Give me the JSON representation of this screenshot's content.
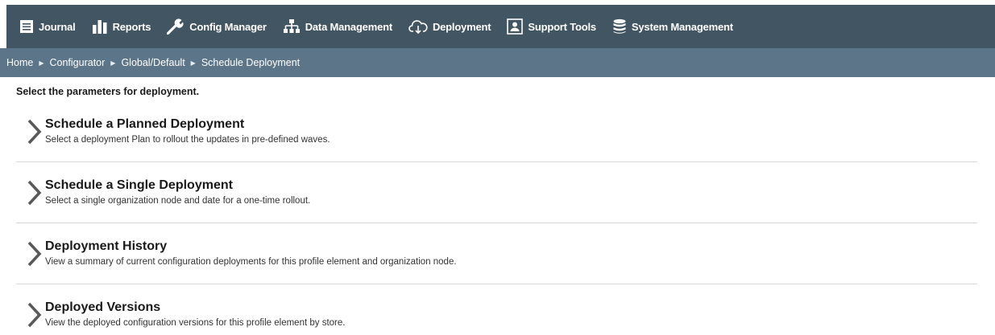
{
  "nav": {
    "items": [
      {
        "label": "Journal",
        "icon": "journal-icon"
      },
      {
        "label": "Reports",
        "icon": "bar-chart-icon"
      },
      {
        "label": "Config Manager",
        "icon": "wrench-icon"
      },
      {
        "label": "Data Management",
        "icon": "hierarchy-icon"
      },
      {
        "label": "Deployment",
        "icon": "cloud-download-icon"
      },
      {
        "label": "Support Tools",
        "icon": "support-person-icon"
      },
      {
        "label": "System Management",
        "icon": "database-icon"
      }
    ]
  },
  "breadcrumb": {
    "items": [
      "Home",
      "Configurator",
      "Global/Default",
      "Schedule Deployment"
    ],
    "separator": "▶"
  },
  "instruction": "Select the parameters for deployment.",
  "options": [
    {
      "title": "Schedule a Planned Deployment",
      "description": "Select a deployment Plan to rollout the updates in pre-defined waves."
    },
    {
      "title": "Schedule a Single Deployment",
      "description": "Select a single organization node and date for a one-time rollout."
    },
    {
      "title": "Deployment History",
      "description": "View a summary of current configuration deployments for this profile element and organization node."
    },
    {
      "title": "Deployed Versions",
      "description": "View the deployed configuration versions for this profile element by store."
    }
  ],
  "colors": {
    "nav_bg": "#425563",
    "breadcrumb_bg": "#5d7588",
    "chevron": "#595959"
  }
}
